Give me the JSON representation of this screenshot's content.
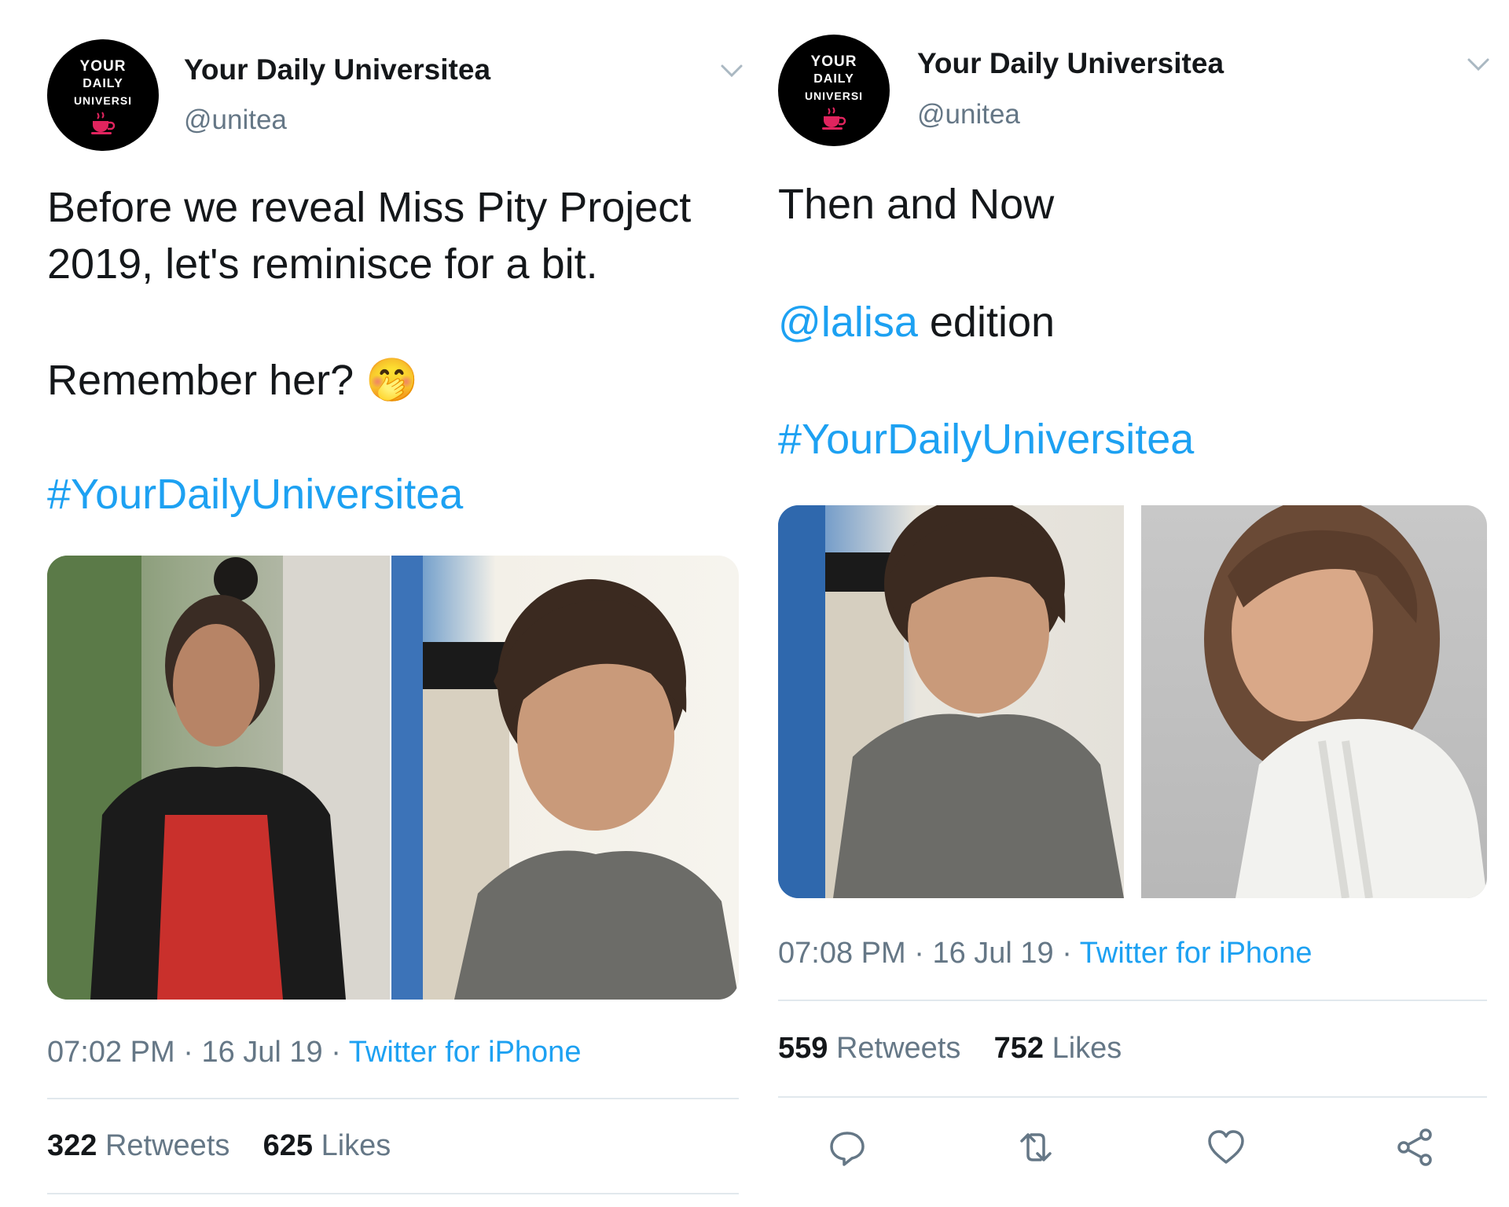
{
  "left_tweet": {
    "avatar": {
      "line1": "YOUR",
      "line2": "DAILY",
      "line3": "UNIVERSI",
      "script": "tea"
    },
    "display_name": "Your Daily Universitea",
    "handle": "@unitea",
    "text_line1": "Before we reveal Miss Pity Project",
    "text_line2": "2019, let's reminisce for a bit.",
    "text_line3": "Remember her?",
    "emoji": "🤭",
    "hashtag": "#YourDailyUniversitea",
    "time": "07:02 PM",
    "date": "16 Jul 19",
    "source": "Twitter for iPhone",
    "retweets_count": "322",
    "retweets_label": "Retweets",
    "likes_count": "625",
    "likes_label": "Likes"
  },
  "right_tweet": {
    "avatar": {
      "line1": "YOUR",
      "line2": "DAILY",
      "line3": "UNIVERSI",
      "script": "tea"
    },
    "display_name": "Your Daily Universitea",
    "handle": "@unitea",
    "text_line1": "Then and Now",
    "mention": "@lalisa",
    "text_line2_rest": " edition",
    "hashtag": "#YourDailyUniversitea",
    "time": "07:08 PM",
    "date": "16 Jul 19",
    "source": "Twitter for iPhone",
    "retweets_count": "559",
    "retweets_label": "Retweets",
    "likes_count": "752",
    "likes_label": "Likes",
    "actions": [
      "reply-icon",
      "retweet-icon",
      "like-icon",
      "share-icon"
    ]
  },
  "colors": {
    "link": "#1da1f2",
    "text": "#14171a",
    "secondary": "#657786",
    "divider": "#e1e8ed",
    "avatar_bg": "#000000",
    "avatar_accent": "#e0245e"
  }
}
